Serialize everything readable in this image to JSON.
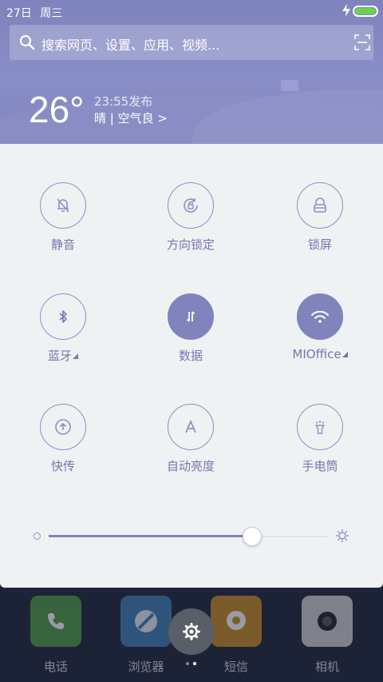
{
  "status_bar": {
    "date": "27日",
    "weekday": "周三",
    "battery_color": "#6bd24a"
  },
  "search": {
    "placeholder": "搜索网页、设置、应用、视频...",
    "icon": "search-icon",
    "scan_icon": "scan-icon"
  },
  "weather": {
    "temperature": "26°",
    "published": "23:55发布",
    "condition": "晴 | 空气良 >"
  },
  "toggles": [
    {
      "label": "静音",
      "icon": "bell-off-icon",
      "active": false,
      "has_menu": false
    },
    {
      "label": "方向锁定",
      "icon": "rotation-lock-icon",
      "active": false,
      "has_menu": false
    },
    {
      "label": "锁屏",
      "icon": "lock-icon",
      "active": false,
      "has_menu": false
    },
    {
      "label": "蓝牙",
      "icon": "bluetooth-icon",
      "active": false,
      "has_menu": true
    },
    {
      "label": "数据",
      "icon": "mobile-data-icon",
      "active": true,
      "has_menu": false
    },
    {
      "label": "MIOffice",
      "icon": "wifi-icon",
      "active": true,
      "has_menu": true
    },
    {
      "label": "快传",
      "icon": "share-upload-icon",
      "active": false,
      "has_menu": false
    },
    {
      "label": "自动亮度",
      "icon": "auto-brightness-icon",
      "active": false,
      "has_menu": false
    },
    {
      "label": "手电筒",
      "icon": "flashlight-icon",
      "active": false,
      "has_menu": false
    }
  ],
  "brightness": {
    "level": 0.73
  },
  "dock": {
    "apps": [
      {
        "label": "电话",
        "icon": "phone-icon"
      },
      {
        "label": "浏览器",
        "icon": "browser-icon"
      },
      {
        "label": "短信",
        "icon": "message-icon"
      },
      {
        "label": "相机",
        "icon": "camera-icon"
      }
    ],
    "settings_icon": "gear-icon",
    "page_count": 2,
    "current_page": 2
  },
  "colors": {
    "accent": "#7f84bd",
    "panel_bg": "#eef2f3",
    "label": "#7477ad"
  }
}
